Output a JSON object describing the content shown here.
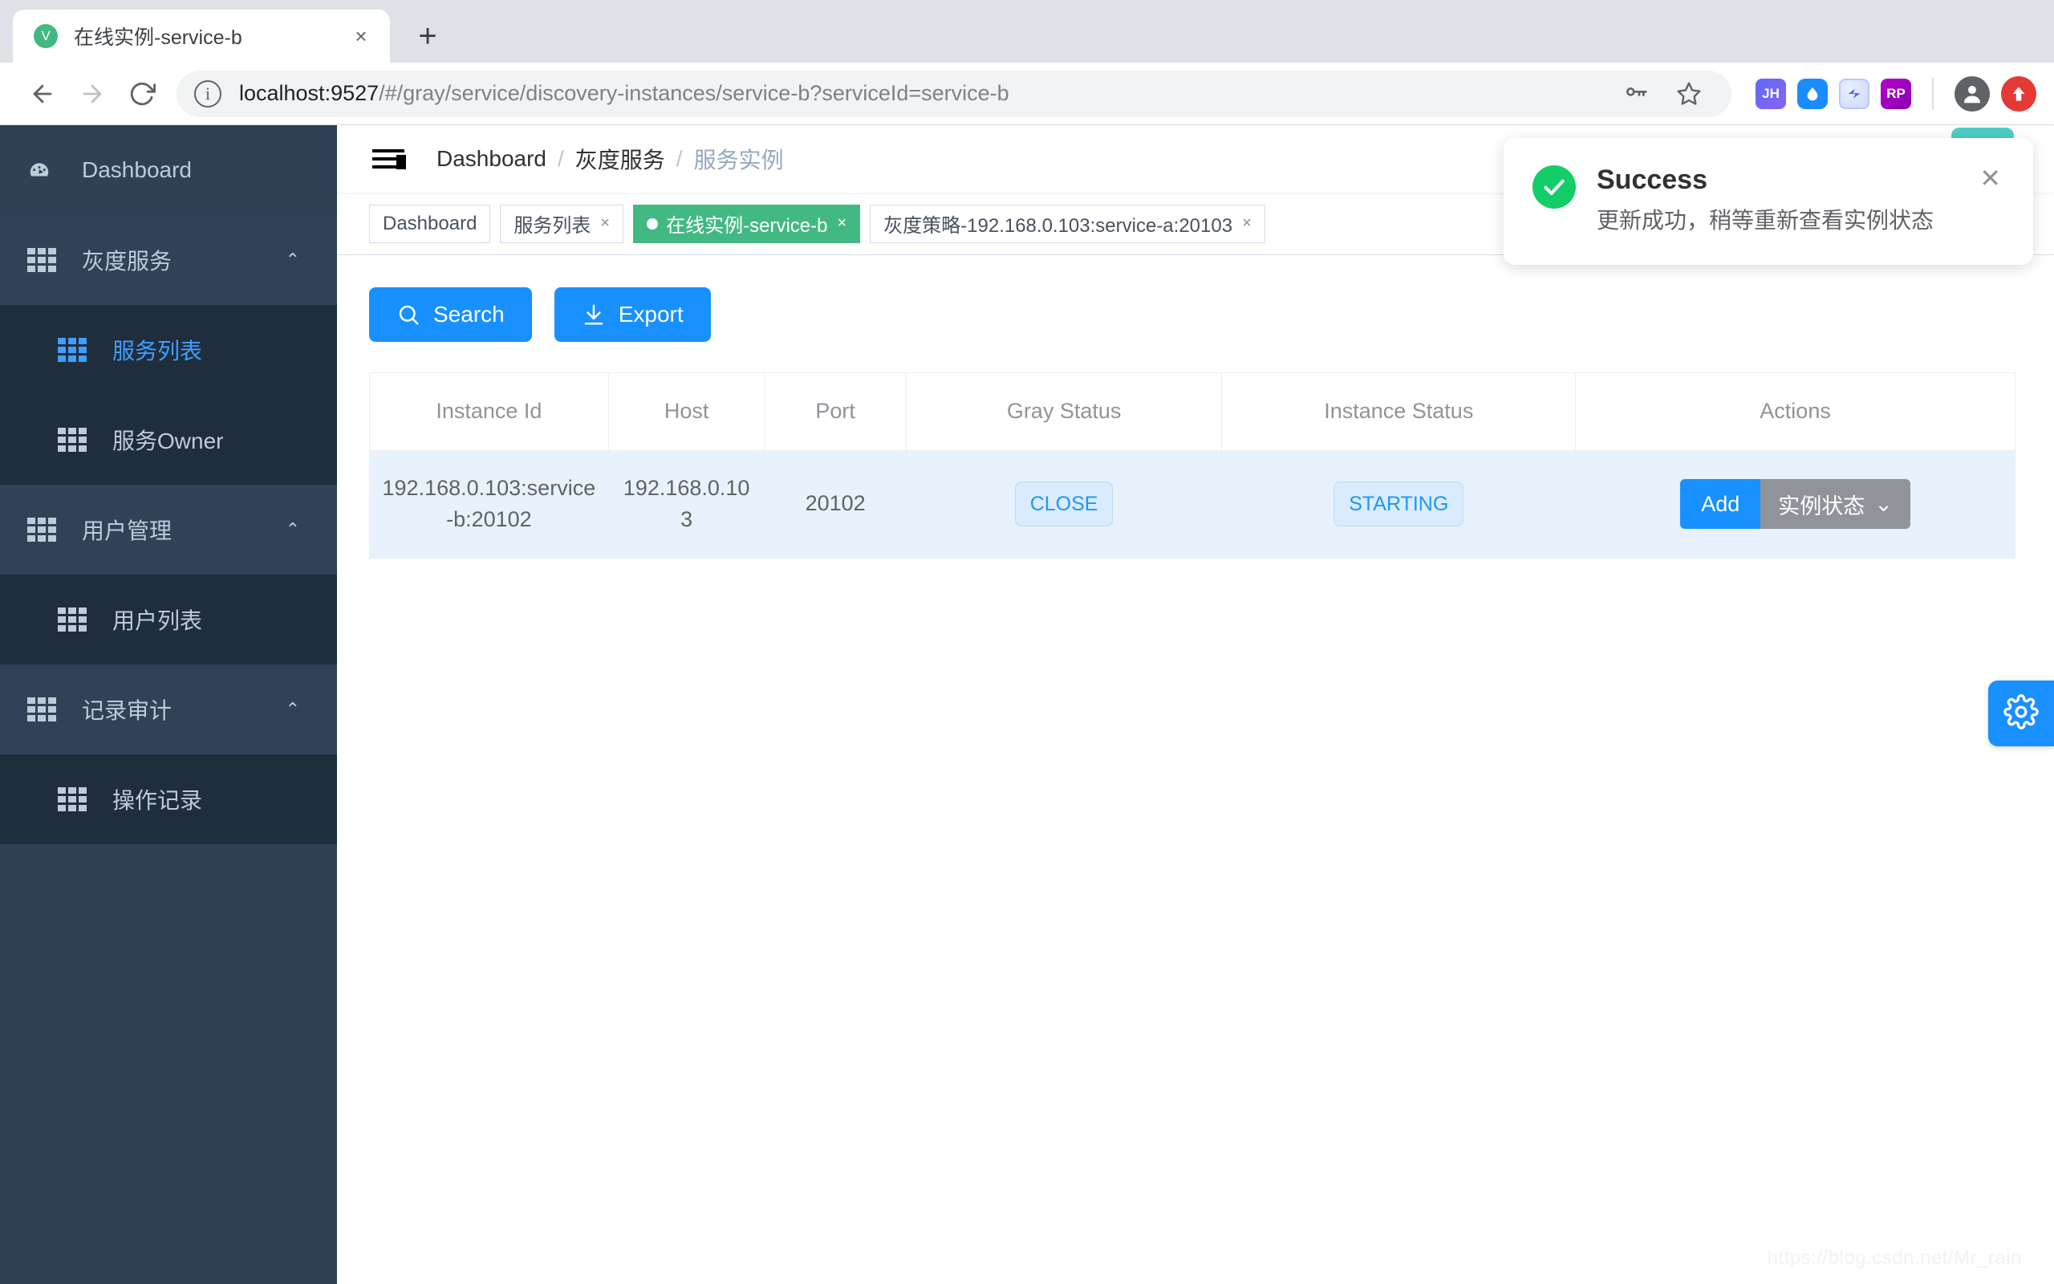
{
  "browser": {
    "tab": {
      "title": "在线实例-service-b",
      "favicon_letter": "V",
      "favicon_name": "vue-favicon",
      "close_label": "×"
    },
    "new_tab_label": "+",
    "back_label": "←",
    "forward_label": "→",
    "reload_label": "⟳",
    "url_secure_part": "localhost:9527",
    "url_rest": "/#/gray/service/discovery-instances/service-b?serviceId=service-b",
    "extensions": [
      {
        "name": "password-key-icon",
        "label": ""
      },
      {
        "name": "bookmark-star-icon",
        "label": ""
      },
      {
        "name": "jh-extension-icon",
        "label": "JH"
      },
      {
        "name": "droplet-extension-icon",
        "label": ""
      },
      {
        "name": "blue-circle-extension-icon",
        "label": ""
      },
      {
        "name": "rp-extension-icon",
        "label": "RP"
      }
    ],
    "profile_name": "profile-avatar",
    "update_name": "update-icon"
  },
  "sidebar": {
    "items": [
      {
        "label": "Dashboard",
        "icon": "dashboard-icon",
        "type": "item",
        "active": false
      },
      {
        "label": "灰度服务",
        "icon": "grid-icon",
        "type": "group",
        "expanded": true,
        "chevron": "⌃"
      },
      {
        "label": "服务列表",
        "icon": "grid-icon",
        "type": "sub",
        "active": true
      },
      {
        "label": "服务Owner",
        "icon": "grid-icon",
        "type": "sub",
        "active": false
      },
      {
        "label": "用户管理",
        "icon": "grid-icon",
        "type": "group",
        "expanded": true,
        "chevron": "⌃"
      },
      {
        "label": "用户列表",
        "icon": "grid-icon",
        "type": "sub",
        "active": false
      },
      {
        "label": "记录审计",
        "icon": "grid-icon",
        "type": "group",
        "expanded": true,
        "chevron": "⌃"
      },
      {
        "label": "操作记录",
        "icon": "grid-icon",
        "type": "sub",
        "active": false
      }
    ]
  },
  "navbar": {
    "hamburger_name": "collapse-sidebar-icon",
    "breadcrumb": [
      {
        "label": "Dashboard",
        "current": false
      },
      {
        "label": "灰度服务",
        "current": false
      },
      {
        "label": "服务实例",
        "current": true
      }
    ],
    "separator": "/"
  },
  "tags_view": {
    "tags": [
      {
        "label": "Dashboard",
        "active": false,
        "closable": false
      },
      {
        "label": "服务列表",
        "active": false,
        "closable": true
      },
      {
        "label": "在线实例-service-b",
        "active": true,
        "closable": true
      },
      {
        "label": "灰度策略-192.168.0.103:service-a:20103",
        "active": false,
        "closable": true
      }
    ],
    "close_label": "×"
  },
  "toolbar": {
    "search_label": "Search",
    "search_icon": "search-icon",
    "export_label": "Export",
    "export_icon": "download-icon"
  },
  "table": {
    "columns": [
      "Instance Id",
      "Host",
      "Port",
      "Gray Status",
      "Instance Status",
      "Actions"
    ],
    "rows": [
      {
        "instance_id": "192.168.0.103:service-b:20102",
        "host": "192.168.0.103",
        "port": "20102",
        "gray_status": "CLOSE",
        "instance_status": "STARTING",
        "action_add": "Add",
        "action_dropdown": "实例状态",
        "action_dropdown_caret": "⌄"
      }
    ]
  },
  "notification": {
    "title": "Success",
    "message": "更新成功，稍等重新查看实例状态",
    "icon": "check-circle-icon",
    "close_label": "✕",
    "accent_color": "#13ce66"
  },
  "floating_settings": {
    "icon": "gear-icon",
    "name": "settings-panel-toggle"
  },
  "watermark": {
    "text": "https://blog.csdn.net/Mr_rain"
  },
  "colors": {
    "primary": "#1890ff",
    "sidebar_bg": "#304156",
    "sidebar_sub_bg": "#1f2d3d",
    "active_tag": "#42b983",
    "success": "#13ce66",
    "row_bg": "#e8f2fd"
  }
}
